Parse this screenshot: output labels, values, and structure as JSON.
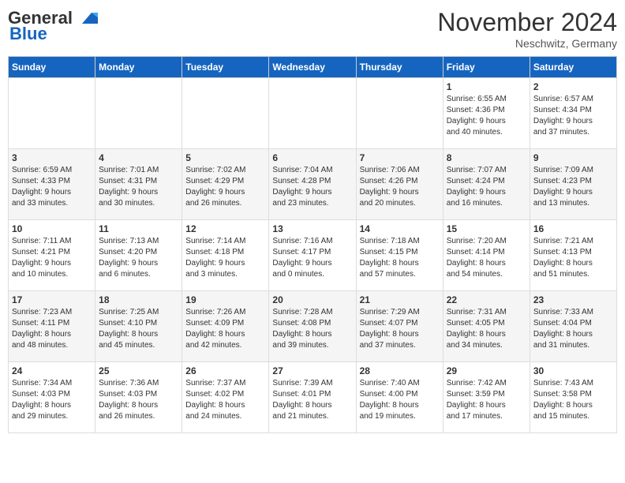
{
  "logo": {
    "general": "General",
    "blue": "Blue"
  },
  "title": "November 2024",
  "location": "Neschwitz, Germany",
  "weekdays": [
    "Sunday",
    "Monday",
    "Tuesday",
    "Wednesday",
    "Thursday",
    "Friday",
    "Saturday"
  ],
  "weeks": [
    [
      {
        "day": "",
        "info": ""
      },
      {
        "day": "",
        "info": ""
      },
      {
        "day": "",
        "info": ""
      },
      {
        "day": "",
        "info": ""
      },
      {
        "day": "",
        "info": ""
      },
      {
        "day": "1",
        "info": "Sunrise: 6:55 AM\nSunset: 4:36 PM\nDaylight: 9 hours\nand 40 minutes."
      },
      {
        "day": "2",
        "info": "Sunrise: 6:57 AM\nSunset: 4:34 PM\nDaylight: 9 hours\nand 37 minutes."
      }
    ],
    [
      {
        "day": "3",
        "info": "Sunrise: 6:59 AM\nSunset: 4:33 PM\nDaylight: 9 hours\nand 33 minutes."
      },
      {
        "day": "4",
        "info": "Sunrise: 7:01 AM\nSunset: 4:31 PM\nDaylight: 9 hours\nand 30 minutes."
      },
      {
        "day": "5",
        "info": "Sunrise: 7:02 AM\nSunset: 4:29 PM\nDaylight: 9 hours\nand 26 minutes."
      },
      {
        "day": "6",
        "info": "Sunrise: 7:04 AM\nSunset: 4:28 PM\nDaylight: 9 hours\nand 23 minutes."
      },
      {
        "day": "7",
        "info": "Sunrise: 7:06 AM\nSunset: 4:26 PM\nDaylight: 9 hours\nand 20 minutes."
      },
      {
        "day": "8",
        "info": "Sunrise: 7:07 AM\nSunset: 4:24 PM\nDaylight: 9 hours\nand 16 minutes."
      },
      {
        "day": "9",
        "info": "Sunrise: 7:09 AM\nSunset: 4:23 PM\nDaylight: 9 hours\nand 13 minutes."
      }
    ],
    [
      {
        "day": "10",
        "info": "Sunrise: 7:11 AM\nSunset: 4:21 PM\nDaylight: 9 hours\nand 10 minutes."
      },
      {
        "day": "11",
        "info": "Sunrise: 7:13 AM\nSunset: 4:20 PM\nDaylight: 9 hours\nand 6 minutes."
      },
      {
        "day": "12",
        "info": "Sunrise: 7:14 AM\nSunset: 4:18 PM\nDaylight: 9 hours\nand 3 minutes."
      },
      {
        "day": "13",
        "info": "Sunrise: 7:16 AM\nSunset: 4:17 PM\nDaylight: 9 hours\nand 0 minutes."
      },
      {
        "day": "14",
        "info": "Sunrise: 7:18 AM\nSunset: 4:15 PM\nDaylight: 8 hours\nand 57 minutes."
      },
      {
        "day": "15",
        "info": "Sunrise: 7:20 AM\nSunset: 4:14 PM\nDaylight: 8 hours\nand 54 minutes."
      },
      {
        "day": "16",
        "info": "Sunrise: 7:21 AM\nSunset: 4:13 PM\nDaylight: 8 hours\nand 51 minutes."
      }
    ],
    [
      {
        "day": "17",
        "info": "Sunrise: 7:23 AM\nSunset: 4:11 PM\nDaylight: 8 hours\nand 48 minutes."
      },
      {
        "day": "18",
        "info": "Sunrise: 7:25 AM\nSunset: 4:10 PM\nDaylight: 8 hours\nand 45 minutes."
      },
      {
        "day": "19",
        "info": "Sunrise: 7:26 AM\nSunset: 4:09 PM\nDaylight: 8 hours\nand 42 minutes."
      },
      {
        "day": "20",
        "info": "Sunrise: 7:28 AM\nSunset: 4:08 PM\nDaylight: 8 hours\nand 39 minutes."
      },
      {
        "day": "21",
        "info": "Sunrise: 7:29 AM\nSunset: 4:07 PM\nDaylight: 8 hours\nand 37 minutes."
      },
      {
        "day": "22",
        "info": "Sunrise: 7:31 AM\nSunset: 4:05 PM\nDaylight: 8 hours\nand 34 minutes."
      },
      {
        "day": "23",
        "info": "Sunrise: 7:33 AM\nSunset: 4:04 PM\nDaylight: 8 hours\nand 31 minutes."
      }
    ],
    [
      {
        "day": "24",
        "info": "Sunrise: 7:34 AM\nSunset: 4:03 PM\nDaylight: 8 hours\nand 29 minutes."
      },
      {
        "day": "25",
        "info": "Sunrise: 7:36 AM\nSunset: 4:03 PM\nDaylight: 8 hours\nand 26 minutes."
      },
      {
        "day": "26",
        "info": "Sunrise: 7:37 AM\nSunset: 4:02 PM\nDaylight: 8 hours\nand 24 minutes."
      },
      {
        "day": "27",
        "info": "Sunrise: 7:39 AM\nSunset: 4:01 PM\nDaylight: 8 hours\nand 21 minutes."
      },
      {
        "day": "28",
        "info": "Sunrise: 7:40 AM\nSunset: 4:00 PM\nDaylight: 8 hours\nand 19 minutes."
      },
      {
        "day": "29",
        "info": "Sunrise: 7:42 AM\nSunset: 3:59 PM\nDaylight: 8 hours\nand 17 minutes."
      },
      {
        "day": "30",
        "info": "Sunrise: 7:43 AM\nSunset: 3:58 PM\nDaylight: 8 hours\nand 15 minutes."
      }
    ]
  ]
}
